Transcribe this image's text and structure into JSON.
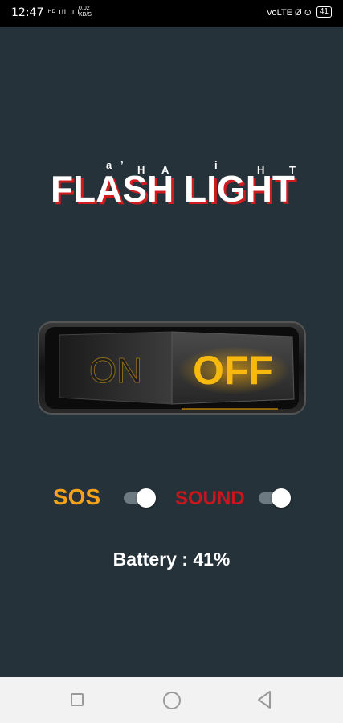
{
  "status_bar": {
    "time": "12:47",
    "signal_text": "ᴴᴰ.ıll .ıll",
    "speed_value": "0.02",
    "speed_unit": "KB/S",
    "right_icons": "VoLTE Ø ⊙",
    "battery_level": "41"
  },
  "app": {
    "title": "FLASH LIGHT",
    "title_color": "#ffffff",
    "title_shadow_color": "#d01c1f",
    "switch": {
      "on_label": "ON",
      "off_label": "OFF",
      "state": "off",
      "off_color": "#f7b90d",
      "on_color": "#2a2a2a"
    },
    "sos": {
      "label": "SOS",
      "enabled": true,
      "color": "#f5a21b"
    },
    "sound": {
      "label": "SOUND",
      "enabled": true,
      "color": "#c8161c"
    },
    "battery_text": "Battery : 41%"
  },
  "navbar": {
    "recent_icon": "square-icon",
    "home_icon": "circle-icon",
    "back_icon": "triangle-back-icon"
  }
}
